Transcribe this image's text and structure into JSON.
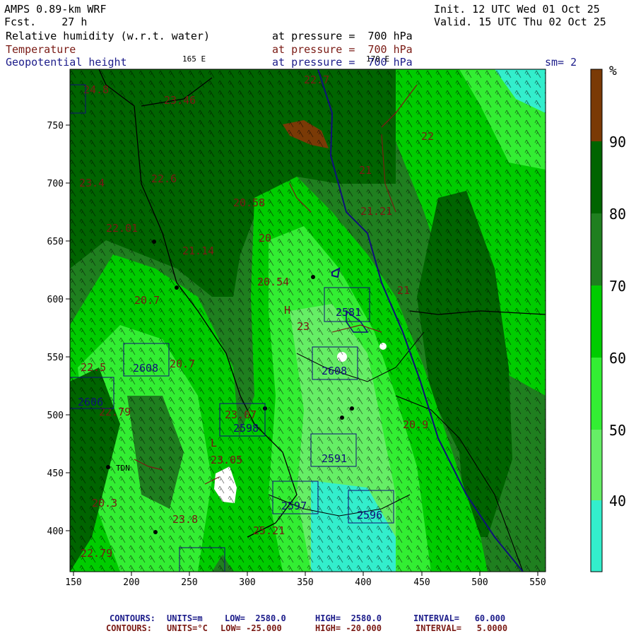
{
  "header": {
    "model": "AMPS 0.89-km WRF",
    "forecast": "Fcst.    27 h",
    "init": "Init. 12 UTC Wed 01 Oct 25",
    "valid": "Valid. 15 UTC Thu 02 Oct 25",
    "field1_name": "Relative humidity (w.r.t. water)",
    "field1_level": "at pressure =  700 hPa",
    "field2_name": "Temperature",
    "field2_level": "at pressure =  700 hPa",
    "field3_name": "Geopotential height",
    "field3_level": "at pressure =  700 hPa",
    "lon_label_left": "165 E",
    "lon_label_right": "170 E",
    "smoothing": "sm= 2"
  },
  "colorbar": {
    "unit": "%",
    "labels": [
      "90",
      "80",
      "70",
      "60",
      "50",
      "40"
    ],
    "colors": {
      "above_90": "#7a3a06",
      "80_90": "#006400",
      "70_80": "#1f7f1f",
      "60_70": "#00cc00",
      "50_60": "#33ee33",
      "40_50": "#66ee66",
      "below_40": "#33eecc"
    }
  },
  "map": {
    "x_ticks": [
      "150",
      "200",
      "250",
      "300",
      "350",
      "400",
      "450",
      "500",
      "550"
    ],
    "y_ticks": [
      "750",
      "700",
      "650",
      "600",
      "550",
      "500",
      "450",
      "400"
    ],
    "temp_labels": [
      "24.8",
      "23.46",
      "22.7",
      "23.4",
      "22.6",
      "20.58",
      "22.01",
      "21.14",
      "20.54",
      "22.5",
      "20.7",
      "22.79",
      "23.07",
      "23.05",
      "23.8",
      "25.21",
      "20.9",
      "20.3",
      "22.79",
      "21.21",
      "20",
      "23",
      "21",
      "20.7",
      "21",
      "22",
      "H",
      "L"
    ],
    "height_boxes": [
      "2581",
      "2608",
      "2606",
      "2608",
      "2598",
      "2591",
      "2597",
      "2596"
    ],
    "station": "TDN"
  },
  "footer": {
    "line1_label": "CONTOURS:",
    "line1_units": "UNITS=m",
    "line1_low": "LOW=  2580.0",
    "line1_high": "HIGH=  2580.0",
    "line1_interval": "INTERVAL=   60.000",
    "line2_label": "CONTOURS:",
    "line2_units": "UNITS=°C",
    "line2_low": "LOW= -25.000",
    "line2_high": "HIGH= -20.000",
    "line2_interval": "INTERVAL=   5.0000"
  }
}
